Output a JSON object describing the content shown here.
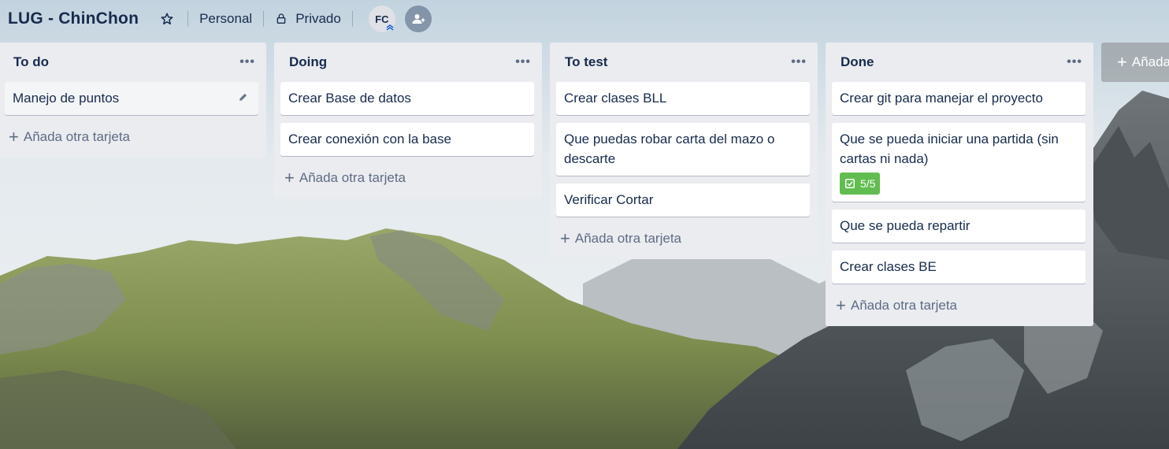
{
  "board": {
    "title": "LUG - ChinChon",
    "team": "Personal",
    "visibility": "Privado",
    "member_initials": "FC"
  },
  "lists": [
    {
      "title": "To do",
      "menu": "•••",
      "cards": [
        {
          "text": "Manejo de puntos"
        }
      ],
      "add_label": "Añada otra tarjeta"
    },
    {
      "title": "Doing",
      "menu": "•••",
      "cards": [
        {
          "text": "Crear Base de datos"
        },
        {
          "text": "Crear conexión con la base"
        }
      ],
      "add_label": "Añada otra tarjeta"
    },
    {
      "title": "To test",
      "menu": "•••",
      "cards": [
        {
          "text": "Crear clases BLL"
        },
        {
          "text": "Que puedas robar carta del mazo o descarte"
        },
        {
          "text": "Verificar Cortar"
        }
      ],
      "add_label": "Añada otra tarjeta"
    },
    {
      "title": "Done",
      "menu": "•••",
      "cards": [
        {
          "text": "Crear git para manejar el proyecto"
        },
        {
          "text": "Que se pueda iniciar una partida (sin cartas ni nada)",
          "checklist": "5/5"
        },
        {
          "text": "Que se pueda repartir"
        },
        {
          "text": "Crear clases BE"
        }
      ],
      "add_label": "Añada otra tarjeta"
    }
  ],
  "add_list_label": "Añada",
  "colors": {
    "list_bg": "#ebecf0",
    "card_bg": "#ffffff",
    "text": "#172b4d",
    "muted": "#5e6c84",
    "badge_green": "#61bd4f"
  },
  "icons": {
    "star": "star-icon",
    "lock": "lock-icon",
    "add_member": "add-member-icon",
    "edit": "pencil-icon",
    "checklist": "checkbox-icon"
  }
}
